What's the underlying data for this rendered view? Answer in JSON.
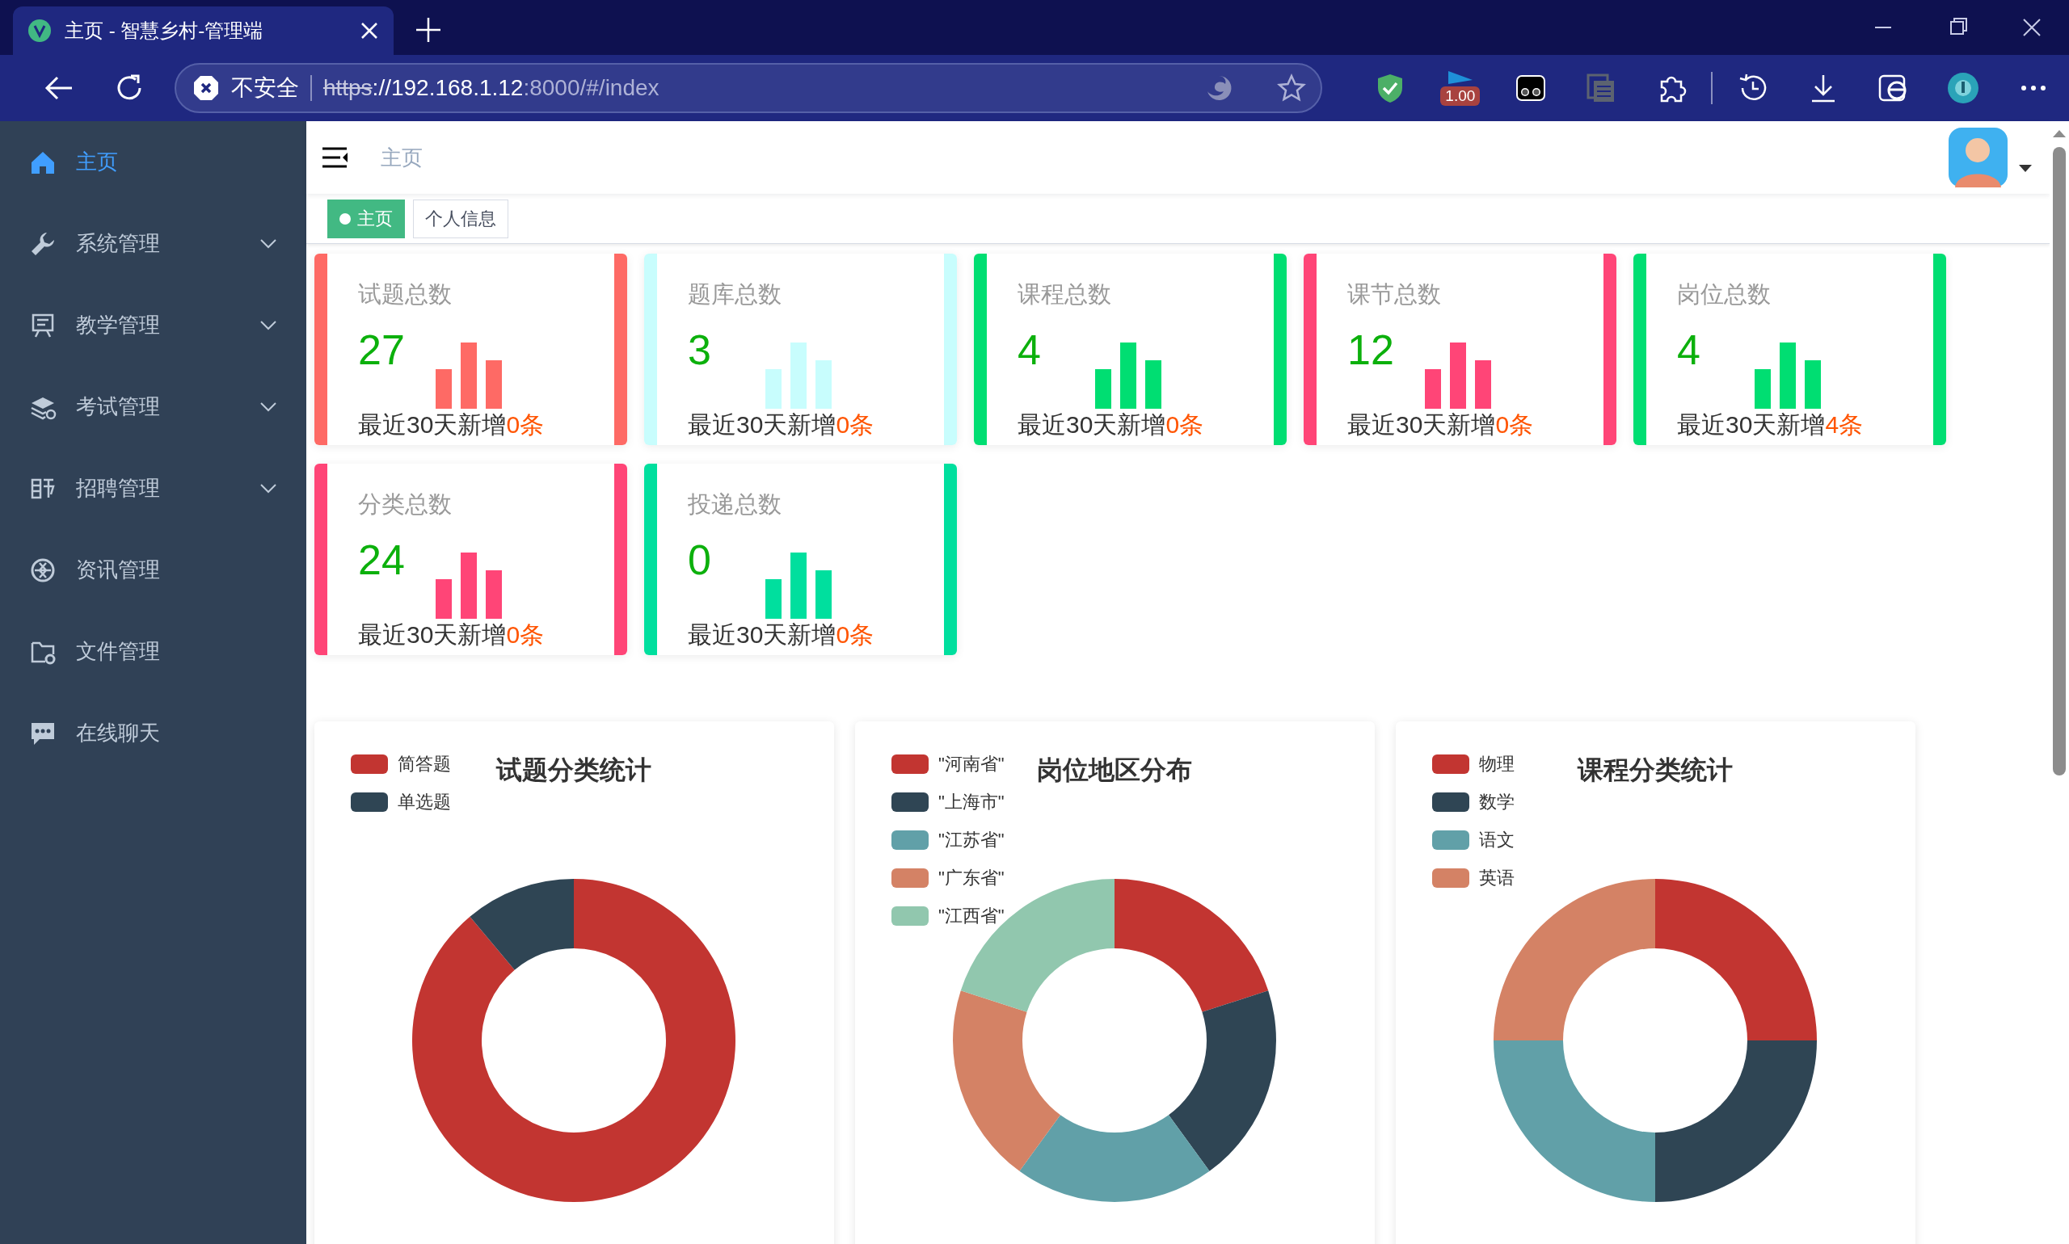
{
  "browser": {
    "tab_title": "主页 - 智慧乡村-管理端",
    "security_label": "不安全",
    "url": {
      "scheme": "https",
      "host": "://192.168.1.12",
      "rest": ":8000/#/index"
    },
    "extension_badge": "1.00"
  },
  "sidebar": {
    "items": [
      {
        "label": "主页",
        "selected": true,
        "expandable": false
      },
      {
        "label": "系统管理",
        "selected": false,
        "expandable": true
      },
      {
        "label": "教学管理",
        "selected": false,
        "expandable": true
      },
      {
        "label": "考试管理",
        "selected": false,
        "expandable": true
      },
      {
        "label": "招聘管理",
        "selected": false,
        "expandable": true
      },
      {
        "label": "资讯管理",
        "selected": false,
        "expandable": false
      },
      {
        "label": "文件管理",
        "selected": false,
        "expandable": false
      },
      {
        "label": "在线聊天",
        "selected": false,
        "expandable": false
      }
    ]
  },
  "header": {
    "breadcrumb": "主页"
  },
  "tags": [
    {
      "label": "主页",
      "selected": true
    },
    {
      "label": "个人信息",
      "selected": false
    }
  ],
  "stats": [
    {
      "title": "试题总数",
      "value": "27",
      "note": "最近30天新增",
      "count": "0条",
      "color": "#fe6a65"
    },
    {
      "title": "题库总数",
      "value": "3",
      "note": "最近30天新增",
      "count": "0条",
      "color": "#c8fdfd"
    },
    {
      "title": "课程总数",
      "value": "4",
      "note": "最近30天新增",
      "count": "0条",
      "color": "#00de72"
    },
    {
      "title": "课节总数",
      "value": "12",
      "note": "最近30天新增",
      "count": "0条",
      "color": "#ff4577"
    },
    {
      "title": "岗位总数",
      "value": "4",
      "note": "最近30天新增",
      "count": "4条",
      "color": "#00de72"
    },
    {
      "title": "分类总数",
      "value": "24",
      "note": "最近30天新增",
      "count": "0条",
      "color": "#ff4577"
    },
    {
      "title": "投递总数",
      "value": "0",
      "note": "最近30天新增",
      "count": "0条",
      "color": "#00df9e"
    }
  ],
  "charts": [
    {
      "title": "试题分类统计",
      "legend": [
        {
          "label": "简答题",
          "color": "#c23531"
        },
        {
          "label": "单选题",
          "color": "#2f4554"
        }
      ]
    },
    {
      "title": "岗位地区分布",
      "legend": [
        {
          "label": "\"河南省\"",
          "color": "#c23531"
        },
        {
          "label": "\"上海市\"",
          "color": "#2f4554"
        },
        {
          "label": "\"江苏省\"",
          "color": "#61a0a8"
        },
        {
          "label": "\"广东省\"",
          "color": "#d48265"
        },
        {
          "label": "\"江西省\"",
          "color": "#91c7ae"
        }
      ]
    },
    {
      "title": "课程分类统计",
      "legend": [
        {
          "label": "物理",
          "color": "#c23531"
        },
        {
          "label": "数学",
          "color": "#2f4554"
        },
        {
          "label": "语文",
          "color": "#61a0a8"
        },
        {
          "label": "英语",
          "color": "#d48265"
        }
      ]
    }
  ]
}
